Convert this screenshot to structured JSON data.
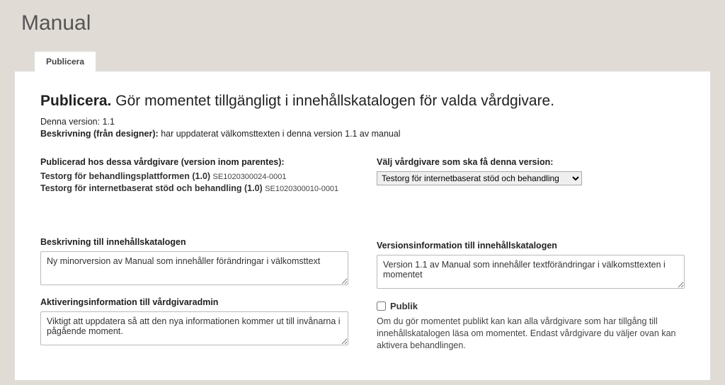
{
  "page": {
    "title": "Manual"
  },
  "tab": {
    "label": "Publicera"
  },
  "headline": {
    "lead": "Publicera.",
    "rest": "Gör momentet tillgängligt i innehållskatalogen för valda vårdgivare."
  },
  "meta": {
    "version_label": "Denna version:",
    "version_value": "1.1",
    "desc_label": "Beskrivning (från designer):",
    "desc_value": "har uppdaterat välkomsttexten i denna version 1.1 av manual"
  },
  "published": {
    "heading": "Publicerad hos dessa vårdgivare (version inom parentes):",
    "items": [
      {
        "name": "Testorg för behandlingsplattformen (1.0)",
        "id": "SE1020300024-0001"
      },
      {
        "name": "Testorg för internetbaserat stöd och behandling (1.0)",
        "id": "SE1020300010-0001"
      }
    ]
  },
  "select_provider": {
    "heading": "Välj vårdgivare som ska få denna version:",
    "selected": "Testorg för internetbaserat stöd och behandling"
  },
  "fields": {
    "catalog_desc": {
      "label": "Beskrivning till innehållskatalogen",
      "value": "Ny minorversion av Manual som innehåller förändringar i välkomsttext"
    },
    "activation_info": {
      "label": "Aktiveringsinformation till vårdgivaradmin",
      "value": "Viktigt att uppdatera så att den nya informationen kommer ut till invånarna i pågående moment."
    },
    "version_info": {
      "label": "Versionsinformation till innehållskatalogen",
      "value": "Version 1.1 av Manual som innehåller textförändringar i välkomsttexten i momentet"
    }
  },
  "public": {
    "label": "Publik",
    "help": "Om du gör momentet publikt kan kan alla vårdgivare som har tillgång till innehållskatalogen läsa om momentet. Endast vårdgivare du väljer ovan kan aktivera behandlingen."
  }
}
